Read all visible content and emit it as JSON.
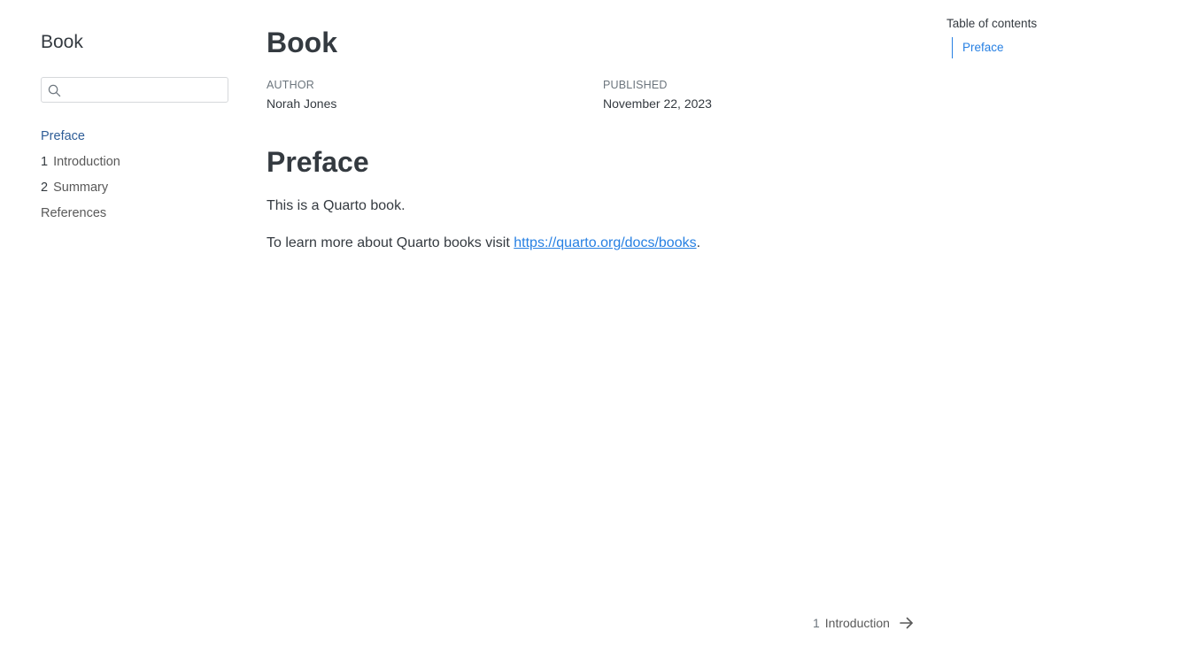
{
  "sidebar": {
    "title": "Book",
    "search": {
      "value": "",
      "placeholder": ""
    },
    "items": [
      {
        "num": "",
        "label": "Preface"
      },
      {
        "num": "1",
        "label": "Introduction"
      },
      {
        "num": "2",
        "label": "Summary"
      },
      {
        "num": "",
        "label": "References"
      }
    ]
  },
  "main": {
    "title": "Book",
    "meta": {
      "author_label": "AUTHOR",
      "author": "Norah Jones",
      "published_label": "PUBLISHED",
      "published": "November 22, 2023"
    },
    "section_title": "Preface",
    "paragraph1": "This is a Quarto book.",
    "paragraph2_prefix": "To learn more about Quarto books visit ",
    "paragraph2_link": "https://quarto.org/docs/books",
    "paragraph2_suffix": "."
  },
  "toc": {
    "title": "Table of contents",
    "items": [
      "Preface"
    ]
  },
  "next_nav": {
    "num": "1",
    "label": "Introduction",
    "icon": "arrow-right-icon"
  },
  "colors": {
    "accent": "#2780e3",
    "active_nav": "#2e5d97",
    "text": "#343a40",
    "muted": "#6c757d"
  }
}
